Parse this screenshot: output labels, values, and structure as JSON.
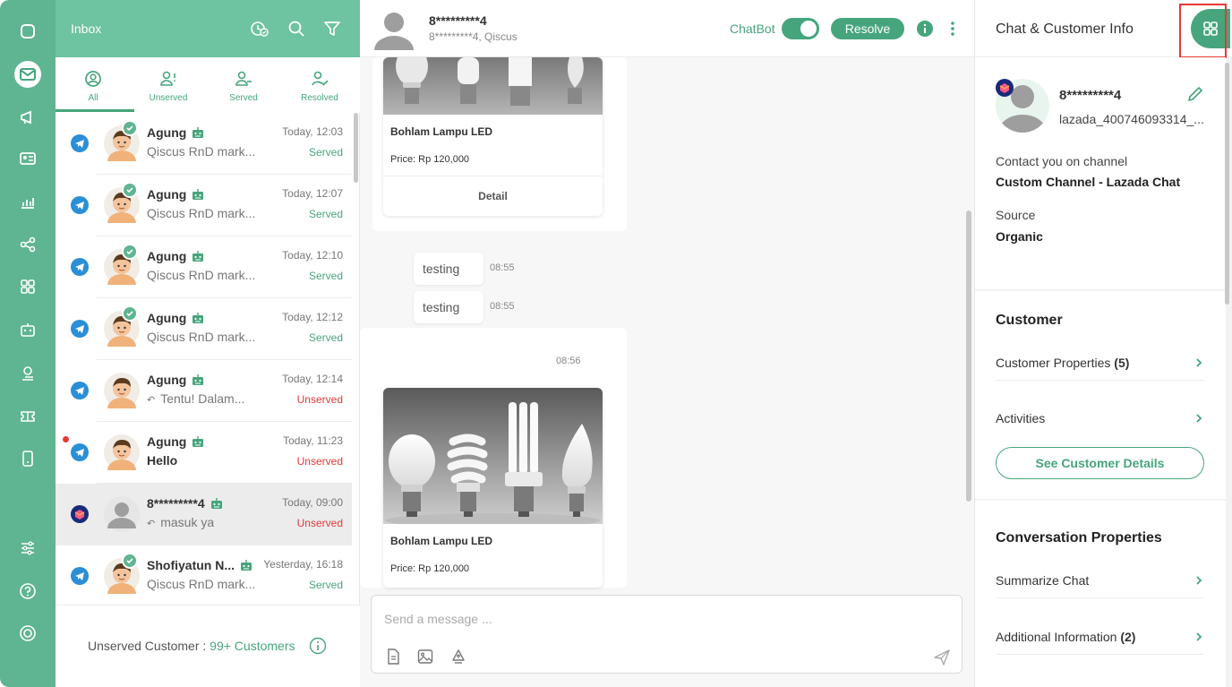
{
  "colors": {
    "primary": "#46a57c",
    "rail": "#5FB591",
    "header": "#6EC3A0",
    "danger": "#e53935"
  },
  "rail": {
    "items": [
      {
        "icon": "chat-square-icon"
      },
      {
        "icon": "mail-icon",
        "active": true
      },
      {
        "icon": "megaphone-icon"
      },
      {
        "icon": "contact-card-icon"
      },
      {
        "icon": "analytics-icon"
      },
      {
        "icon": "share-icon"
      },
      {
        "icon": "apps-grid-icon"
      },
      {
        "icon": "robot-icon"
      },
      {
        "icon": "agent-icon"
      },
      {
        "icon": "ticket-icon"
      },
      {
        "icon": "mobile-icon"
      },
      {
        "icon": "settings-sliders-icon"
      },
      {
        "icon": "help-icon"
      },
      {
        "icon": "power-icon"
      }
    ]
  },
  "inbox": {
    "title": "Inbox",
    "tabs": [
      {
        "label": "All",
        "active": true
      },
      {
        "label": "Unserved"
      },
      {
        "label": "Served"
      },
      {
        "label": "Resolved"
      }
    ],
    "rooms": [
      {
        "name": "Agung",
        "message": "Qiscus RnD mark...",
        "time": "Today, 12:03",
        "status": "Served",
        "served": true
      },
      {
        "name": "Agung",
        "message": "Qiscus RnD mark...",
        "time": "Today, 12:07",
        "status": "Served",
        "served": true
      },
      {
        "name": "Agung",
        "message": "Qiscus RnD mark...",
        "time": "Today, 12:10",
        "status": "Served",
        "served": true
      },
      {
        "name": "Agung",
        "message": "Qiscus RnD mark...",
        "time": "Today, 12:12",
        "status": "Served",
        "served": true
      },
      {
        "name": "Agung",
        "message": "Tentu! Dalam...",
        "time": "Today, 12:14",
        "status": "Unserved",
        "served": false,
        "reply": true
      },
      {
        "name": "Agung",
        "message": "Hello",
        "time": "Today, 11:23",
        "status": "Unserved",
        "served": false,
        "unread": true
      },
      {
        "name": "8*********4",
        "message": "masuk ya",
        "time": "Today, 09:00",
        "status": "Unserved",
        "served": false,
        "reply": true,
        "selected": true,
        "lazada": true
      },
      {
        "name": "Shofiyatun N...",
        "message": "Qiscus RnD mark...",
        "time": "Yesterday, 16:18",
        "status": "Served",
        "served": true
      }
    ],
    "footer": {
      "label": "Unserved Customer :",
      "count": "99+ Customers"
    }
  },
  "chat": {
    "name": "8*********4",
    "subtitle": "8*********4, Qiscus",
    "chatbot_label": "ChatBot",
    "resolve_label": "Resolve",
    "product1": {
      "title": "Bohlam Lampu LED",
      "price": "Price: Rp 120,000",
      "detail": "Detail"
    },
    "messages": [
      {
        "text": "testing",
        "time": "08:55"
      },
      {
        "text": "testing",
        "time": "08:55"
      }
    ],
    "card_time": "08:56",
    "product2": {
      "title": "Bohlam Lampu LED",
      "price": "Price: Rp 120,000"
    },
    "composer_placeholder": "Send a message ..."
  },
  "info": {
    "title": "Chat & Customer Info",
    "customer_name": "8*********4",
    "customer_id": "lazada_400746093314_...",
    "channel_label": "Contact you on channel",
    "channel_value": "Custom Channel - Lazada Chat",
    "source_label": "Source",
    "source_value": "Organic",
    "customer_section": "Customer",
    "customer_properties": "Customer Properties",
    "customer_properties_count": "(5)",
    "activities": "Activities",
    "see_details": "See Customer Details",
    "conversation_section": "Conversation Properties",
    "summarize_chat": "Summarize Chat",
    "additional_information": "Additional Information",
    "additional_information_count": "(2)"
  }
}
